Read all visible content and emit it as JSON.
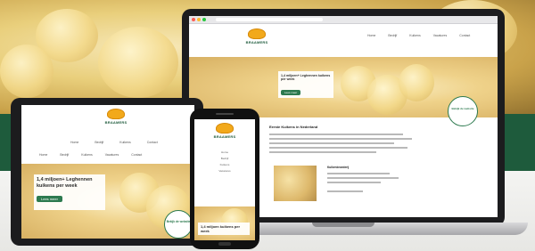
{
  "site": {
    "brand": "BRAAMERS",
    "nav": [
      "Home",
      "Bedrijf",
      "Kuikens",
      "Vacatures",
      "Contact"
    ],
    "hero_title": "1,4 miljoen+ Leghennen kuikens per week",
    "hero_button": "Lees meer",
    "badge_text": "Bekijk de website",
    "section_heading": "Eerste Kuikens in Nederland",
    "side_heading": "Kuikenbroederij",
    "phone_hero_title": "1,4 miljoen kuikens per week",
    "tablet_nav": [
      "Home",
      "Bedrijf",
      "Kuikens",
      "Contact"
    ]
  },
  "colors": {
    "brand_green": "#1e5b3c",
    "accent_orange": "#f2a91b",
    "button_green": "#2d7a4f"
  }
}
